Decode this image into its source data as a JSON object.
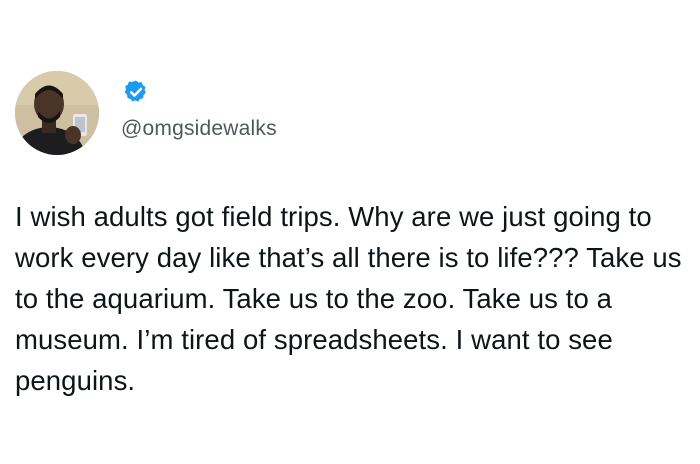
{
  "tweet": {
    "handle": "@omgsidewalks",
    "verified": true,
    "text": "I wish adults got field trips. Why are we just going to work every day like that’s all there is to life??? Take us to the aquarium. Take us to the zoo. Take us to a museum. I’m tired of spreadsheets. I want to see penguins."
  },
  "colors": {
    "background": "#ffffff",
    "text": "#0f1419",
    "handle": "#50575e",
    "verified_badge": "#1d9bf0"
  },
  "icons": {
    "verified": "verified-badge-icon",
    "avatar": "profile-photo"
  }
}
